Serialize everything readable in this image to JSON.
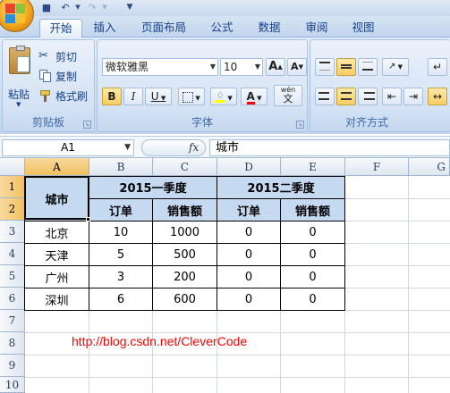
{
  "tabs": [
    "开始",
    "插入",
    "页面布局",
    "公式",
    "数据",
    "审阅",
    "视图"
  ],
  "clipboard": {
    "paste": "粘贴",
    "cut": "剪切",
    "copy": "复制",
    "format_painter": "格式刷",
    "label": "剪贴板"
  },
  "font": {
    "name": "微软雅黑",
    "size": "10",
    "grow": "A",
    "shrink": "A",
    "bold": "B",
    "italic": "I",
    "underline": "U",
    "color_letter": "A",
    "wen": "wén",
    "wen_char": "文",
    "label": "字体"
  },
  "alignment": {
    "label": "对齐方式"
  },
  "namebox": "A1",
  "fx": "fx",
  "formula": "城市",
  "columns": [
    "A",
    "B",
    "C",
    "D",
    "E",
    "F",
    "G"
  ],
  "rows": [
    "1",
    "2",
    "3",
    "4",
    "5",
    "6",
    "7",
    "8",
    "9",
    "10"
  ],
  "table": {
    "city_header": "城市",
    "q1_header": "2015一季度",
    "q2_header": "2015二季度",
    "sub_headers": [
      "订单",
      "销售额",
      "订单",
      "销售额"
    ],
    "rows": [
      [
        "北京",
        "10",
        "1000",
        "0",
        "0"
      ],
      [
        "天津",
        "5",
        "500",
        "0",
        "0"
      ],
      [
        "广州",
        "3",
        "200",
        "0",
        "0"
      ],
      [
        "深圳",
        "6",
        "600",
        "0",
        "0"
      ]
    ]
  },
  "link_text": "http://blog.csdn.net/CleverCode",
  "colors": {
    "header_fill": "#c5d9f1",
    "link": "#ff0000",
    "selected_header": "#f1c15f"
  }
}
